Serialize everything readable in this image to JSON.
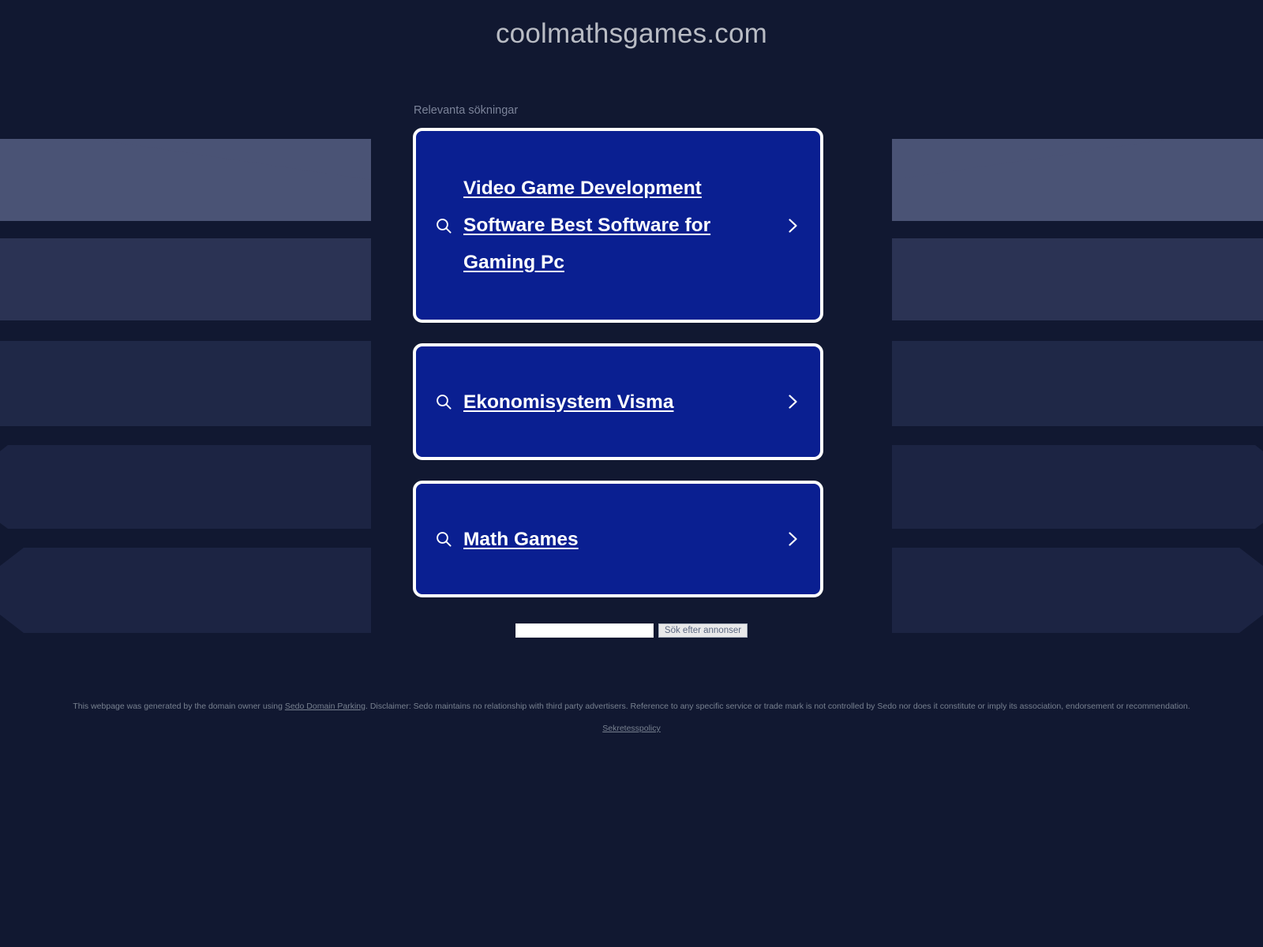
{
  "page": {
    "background_color": "#111831",
    "title": "coolmathsgames.com"
  },
  "related": {
    "label": "Relevanta sökningar"
  },
  "ads": {
    "card_fill_color": "#0a1f91",
    "card_border_color": "#fdfdfd",
    "items": [
      {
        "title": "Video Game Development Software Best Software for Gaming Pc",
        "search_icon": "search-icon",
        "arrow_icon": "chevron-right-icon"
      },
      {
        "title": "Ekonomisystem Visma",
        "search_icon": "search-icon",
        "arrow_icon": "chevron-right-icon"
      },
      {
        "title": "Math Games",
        "search_icon": "search-icon",
        "arrow_icon": "chevron-right-icon"
      }
    ]
  },
  "search": {
    "value": "",
    "placeholder": "",
    "button_label": "Sök efter annonser"
  },
  "footer": {
    "disclaimer_before": "This webpage was generated by the domain owner using ",
    "disclaimer_link": "Sedo Domain Parking",
    "disclaimer_after": ". Disclaimer: Sedo maintains no relationship with third party advertisers. Reference to any specific service or trade mark is not controlled by Sedo nor does it constitute or imply its association, endorsement or recommendation.",
    "privacy_label": "Sekretesspolicy"
  }
}
